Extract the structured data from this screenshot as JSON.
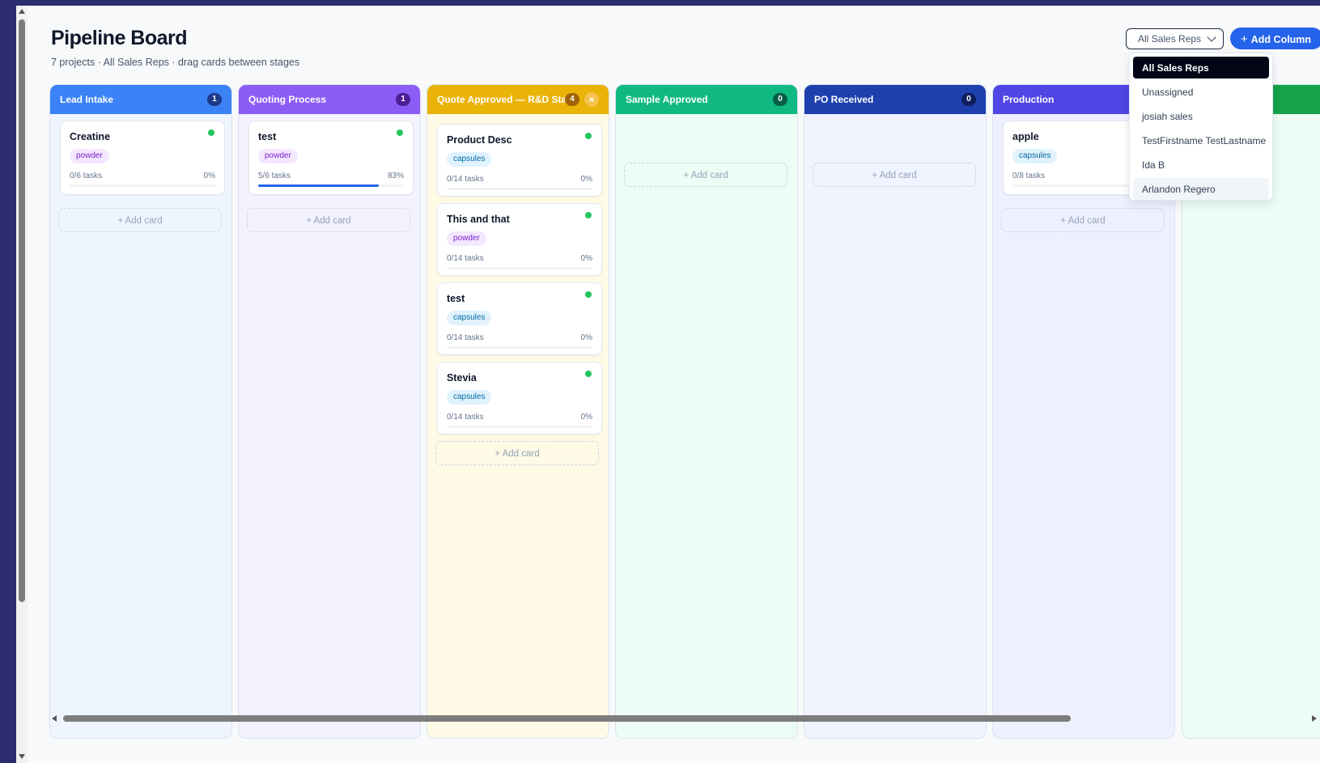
{
  "header": {
    "title": "Pipeline Board",
    "subtitle": "7 projects · All Sales Reps · drag cards between stages"
  },
  "toolbar": {
    "rep_filter_value": "All Sales Reps",
    "add_column_label": "Add Column",
    "add_column_icon": "+"
  },
  "rep_dropdown": {
    "options": [
      "All Sales Reps",
      "Unassigned",
      "josiah sales",
      "TestFirstname TestLastname",
      "Ida B",
      "Arlandon Regero"
    ],
    "selected": "All Sales Reps",
    "hovered": "Arlandon Regero"
  },
  "colors": {
    "lead_intake": "#3b82f6",
    "quoting_process": "#8b5cf6",
    "quote_approved": "#eab308",
    "sample_approved": "#10b981",
    "po_received": "#1e40af",
    "production": "#4f46e5",
    "next_column": "#16a34a",
    "accent": "#2563eb"
  },
  "add_card_label": "+ Add card",
  "columns": [
    {
      "name": "Lead Intake",
      "count": "1",
      "cards": [
        {
          "title": "Creatine",
          "tag": "powder",
          "tasks": "0/6 tasks",
          "pct": "0%",
          "progress": 0
        }
      ]
    },
    {
      "name": "Quoting Process",
      "count": "1",
      "cards": [
        {
          "title": "test",
          "tag": "powder",
          "tasks": "5/6 tasks",
          "pct": "83%",
          "progress": 0.83
        }
      ]
    },
    {
      "name": "Quote Approved — R&D Sta...",
      "count": "4",
      "close_icon": "×",
      "cards": [
        {
          "title": "Product Desc",
          "tag": "capsules",
          "tasks": "0/14 tasks",
          "pct": "0%",
          "progress": 0
        },
        {
          "title": "This and that",
          "tag": "powder",
          "tasks": "0/14 tasks",
          "pct": "0%",
          "progress": 0
        },
        {
          "title": "test",
          "tag": "capsules",
          "tasks": "0/14 tasks",
          "pct": "0%",
          "progress": 0
        },
        {
          "title": "Stevia",
          "tag": "capsules",
          "tasks": "0/14 tasks",
          "pct": "0%",
          "progress": 0
        }
      ]
    },
    {
      "name": "Sample Approved",
      "count": "0",
      "cards": []
    },
    {
      "name": "PO Received",
      "count": "0",
      "cards": []
    },
    {
      "name": "Production",
      "count": "",
      "cards": [
        {
          "title": "apple",
          "tag": "capsules",
          "tasks": "0/8 tasks",
          "pct": "",
          "progress": 0
        }
      ]
    }
  ]
}
